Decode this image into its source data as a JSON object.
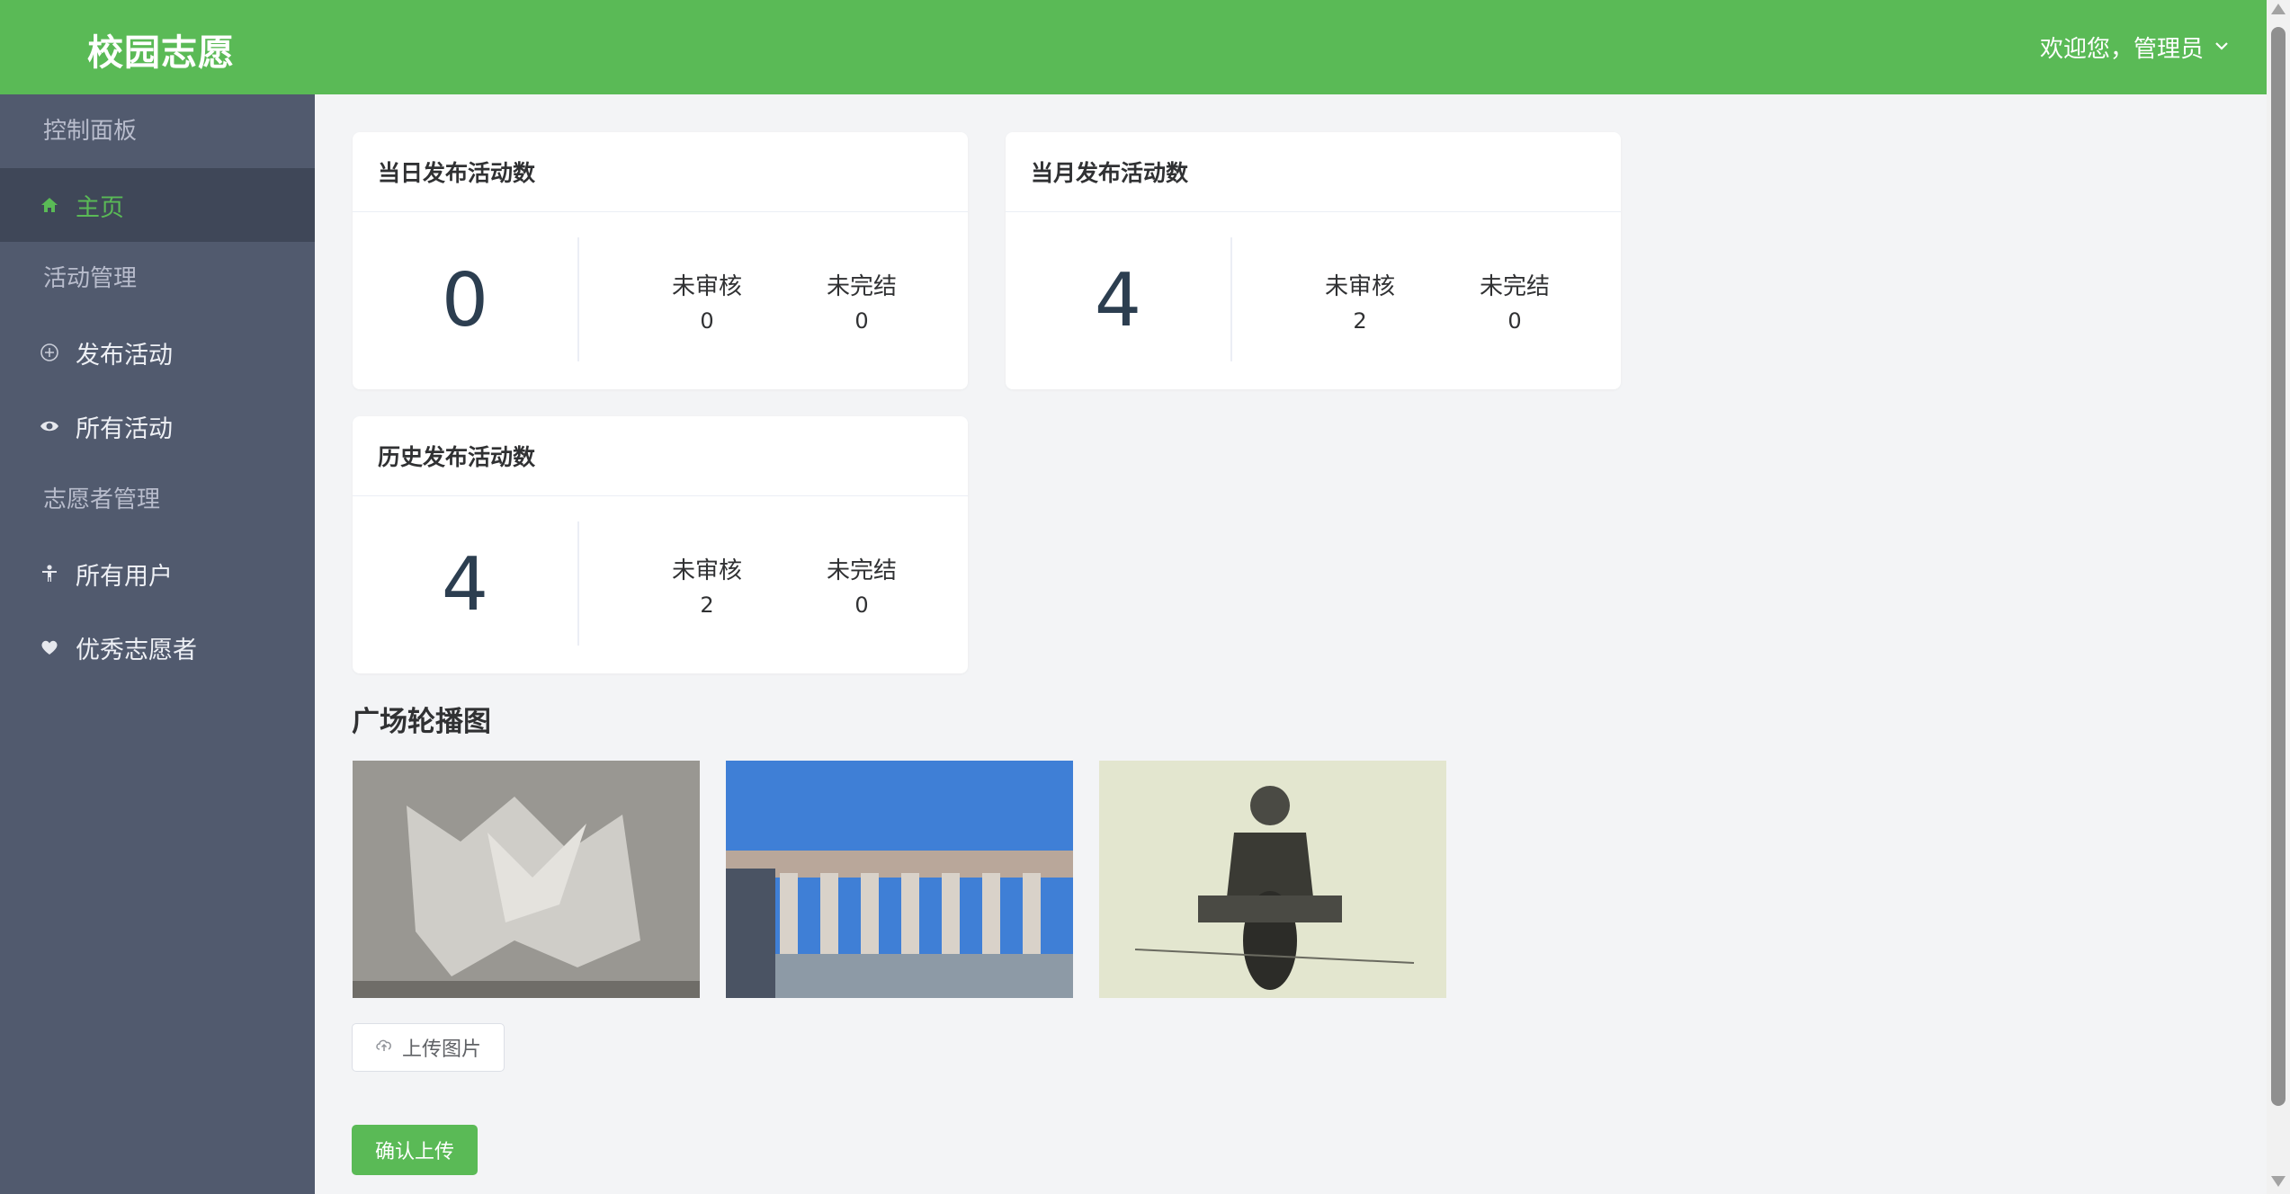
{
  "header": {
    "logo": "校园志愿",
    "welcome": "欢迎您，管理员",
    "chevron_icon": "chevron-down-icon"
  },
  "sidebar": {
    "group_dashboard": "控制面板",
    "group_activity": "活动管理",
    "group_volunteer": "志愿者管理",
    "items": [
      {
        "label": "主页",
        "icon": "home-icon"
      },
      {
        "label": "发布活动",
        "icon": "plus-circle-icon"
      },
      {
        "label": "所有活动",
        "icon": "eye-icon"
      },
      {
        "label": "所有用户",
        "icon": "person-icon"
      },
      {
        "label": "优秀志愿者",
        "icon": "heart-icon"
      }
    ]
  },
  "stats": {
    "daily": {
      "title": "当日发布活动数",
      "total": "0",
      "pending_label": "未审核",
      "pending": "0",
      "unfinished_label": "未完结",
      "unfinished": "0"
    },
    "monthly": {
      "title": "当月发布活动数",
      "total": "4",
      "pending_label": "未审核",
      "pending": "2",
      "unfinished_label": "未完结",
      "unfinished": "0"
    },
    "history": {
      "title": "历史发布活动数",
      "total": "4",
      "pending_label": "未审核",
      "pending": "2",
      "unfinished_label": "未完结",
      "unfinished": "0"
    }
  },
  "carousel": {
    "title": "广场轮播图",
    "upload_label": "上传图片",
    "upload_icon": "upload-cloud-icon",
    "confirm_label": "确认上传"
  },
  "colors": {
    "brand": "#5aba56",
    "sidebar": "#515a6e",
    "sidebar_active": "#3f4758"
  }
}
